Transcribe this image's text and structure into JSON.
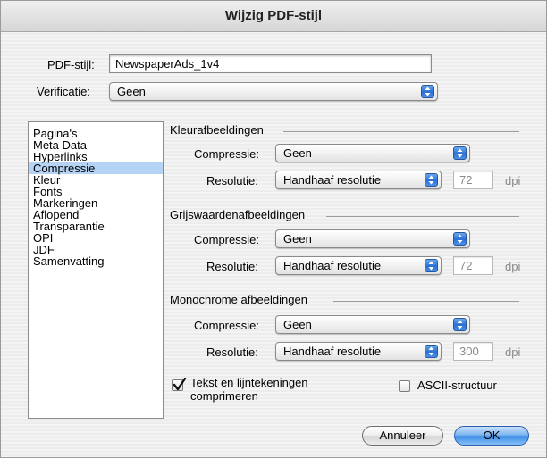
{
  "window": {
    "title": "Wijzig PDF-stijl"
  },
  "header": {
    "pdf_style_label": "PDF-stijl:",
    "pdf_style_value": "NewspaperAds_1v4",
    "verification_label": "Verificatie:",
    "verification_value": "Geen"
  },
  "sidebar": {
    "items": [
      "Pagina's",
      "Meta Data",
      "Hyperlinks",
      "Compressie",
      "Kleur",
      "Fonts",
      "Markeringen",
      "Aflopend",
      "Transparantie",
      "OPI",
      "JDF",
      "Samenvatting"
    ],
    "selected": "Compressie"
  },
  "sections": [
    {
      "title": "Kleurafbeeldingen",
      "compression_label": "Compressie:",
      "compression_value": "Geen",
      "resolution_label": "Resolutie:",
      "resolution_value": "Handhaaf resolutie",
      "dpi_value": "72",
      "dpi_unit": "dpi"
    },
    {
      "title": "Grijswaardenafbeeldingen",
      "compression_label": "Compressie:",
      "compression_value": "Geen",
      "resolution_label": "Resolutie:",
      "resolution_value": "Handhaaf resolutie",
      "dpi_value": "72",
      "dpi_unit": "dpi"
    },
    {
      "title": "Monochrome afbeeldingen",
      "compression_label": "Compressie:",
      "compression_value": "Geen",
      "resolution_label": "Resolutie:",
      "resolution_value": "Handhaaf resolutie",
      "dpi_value": "300",
      "dpi_unit": "dpi"
    }
  ],
  "options": {
    "compress_text_label_line1": "Tekst en lijntekeningen",
    "compress_text_label_line2": "comprimeren",
    "compress_text_checked": true,
    "ascii_label": "ASCII-structuur",
    "ascii_checked": false
  },
  "buttons": {
    "cancel": "Annuleer",
    "ok": "OK"
  },
  "colors": {
    "selection": "#b5d3f4",
    "accent": "#3d8de8"
  }
}
